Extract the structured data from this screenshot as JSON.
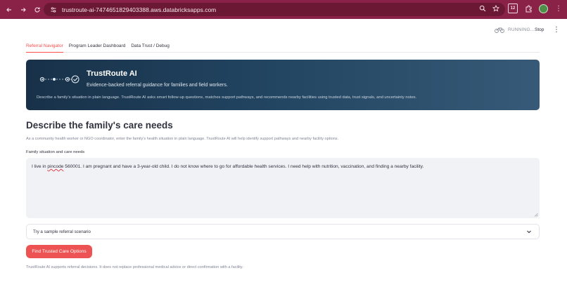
{
  "browser": {
    "url": "trustroute-ai-7474651829403388.aws.databricksapps.com",
    "ext_badge": "12"
  },
  "header": {
    "status": "RUNNING...",
    "stop_label": "Stop",
    "menu_glyph": "⋮"
  },
  "tabs": [
    {
      "label": "Referral Navigator",
      "active": true
    },
    {
      "label": "Program Leader Dashboard",
      "active": false
    },
    {
      "label": "Data Trust / Debug",
      "active": false
    }
  ],
  "hero": {
    "title": "TrustRoute AI",
    "subtitle": "Evidence-backed referral guidance for families and field workers.",
    "description": "Describe a family's situation in plain language. TrustRoute AI asks smart follow-up questions, matches support pathways, and recommends nearby facilities using trusted data, trust signals, and uncertainty notes."
  },
  "main": {
    "heading": "Describe the family's care needs",
    "intro": "As a community health worker or NGO coordinator, enter the family's health situation in plain language. TrustRoute AI will help identify support pathways and nearby facility options.",
    "field_label": "Family situation and care needs",
    "textarea_pre": "I live in ",
    "textarea_squiggle": "pincode",
    "textarea_post": " 560001. I am pregnant and have a 3-year-old child. I do not know where to go for affordable health services. I need help with nutrition, vaccination, and finding a nearby facility.",
    "sample_select": "Try a sample referral scenario",
    "cta_label": "Find Trusted Care Options",
    "disclaimer": "TrustRoute AI supports referral decisions. It does not replace professional medical advice or direct confirmation with a facility."
  },
  "colors": {
    "accent": "#ff4b4b",
    "cta": "#ee5353",
    "chrome": "#8a2146",
    "hero_start": "#183149",
    "hero_end": "#365a77"
  },
  "icons": [
    "back-arrow-icon",
    "forward-arrow-icon",
    "reload-icon",
    "site-settings-icon",
    "zoom-icon",
    "bookmark-star-icon",
    "extensions-icon",
    "bike-icon",
    "chevron-down-icon",
    "trustroute-logo-icon"
  ]
}
